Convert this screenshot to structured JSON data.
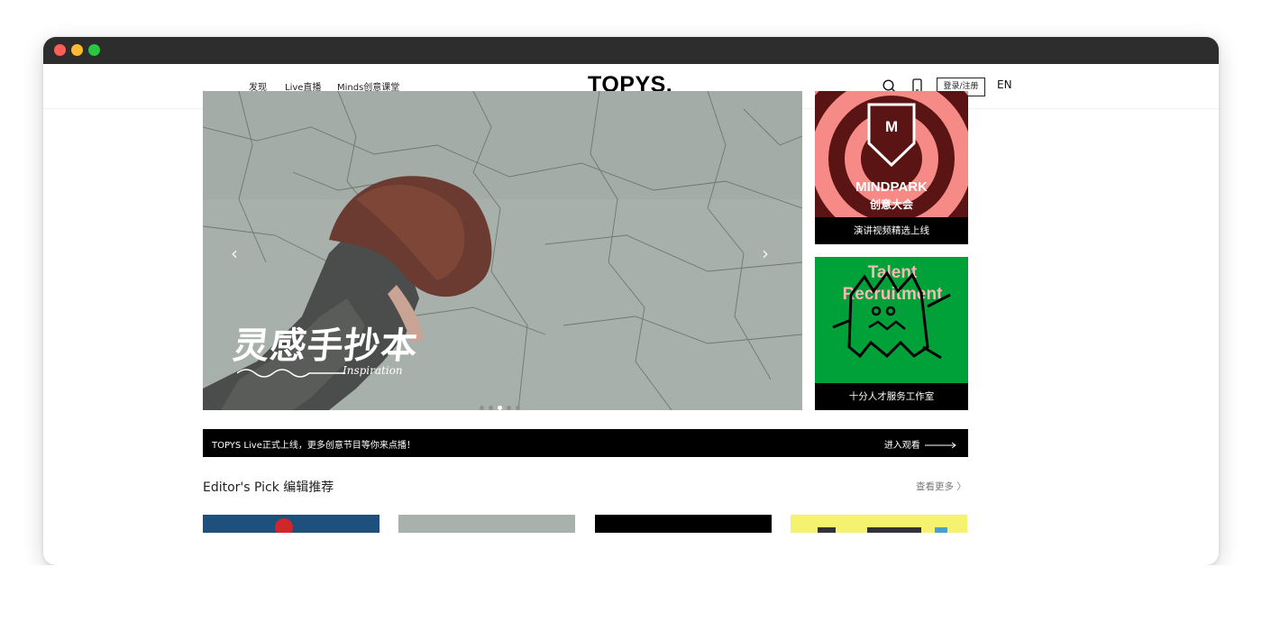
{
  "header": {
    "nav": [
      "发现",
      "Live直播",
      "Minds创意课堂"
    ],
    "logo": "TOPYS.",
    "login_label": "登录/注册",
    "lang_label": "EN",
    "icons": [
      "search-icon",
      "mobile-icon"
    ]
  },
  "hero": {
    "title": "灵感手抄本",
    "subtitle": "Inspiration",
    "slide_count": 5,
    "active_slide": 3
  },
  "promos": [
    {
      "image_text_1": "MINDPARK",
      "image_text_2": "创意大会",
      "badge": "M",
      "caption": "演讲视频精选上线"
    },
    {
      "image_text": "Talent Recruitment",
      "caption": "十分人才服务工作室"
    }
  ],
  "live_bar": {
    "text": "TOPYS Live正式上线，更多创意节目等你来点播！",
    "action": "进入观看"
  },
  "section": {
    "title": "Editor's Pick 编辑推荐",
    "more": "查看更多 〉"
  },
  "colors": {
    "accent_promo1": "#f58a86",
    "promo1_dark": "#5a1414",
    "accent_promo2": "#00a138",
    "thumb_colors": [
      "#1f4f7d",
      "#a8b1ac",
      "#000000",
      "#f5f36e"
    ]
  }
}
